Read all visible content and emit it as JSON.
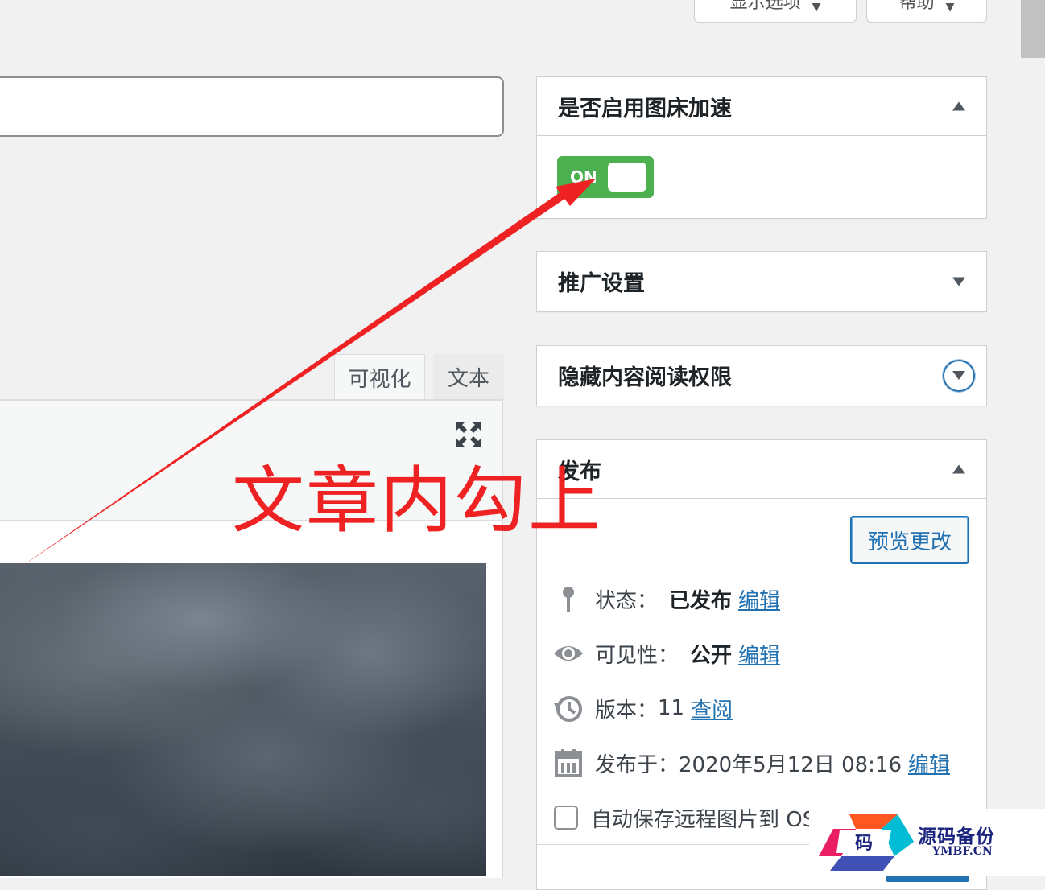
{
  "header": {
    "screen_options_label": "显示选项",
    "help_label": "帮助"
  },
  "editor": {
    "tab_visual": "可视化",
    "tab_text": "文本"
  },
  "boxes": {
    "image_accel": {
      "title": "是否启用图床加速",
      "switch_label": "ON",
      "enabled": true
    },
    "promo": {
      "title": "推广设置"
    },
    "hidden_content": {
      "title": "隐藏内容阅读权限"
    },
    "publish": {
      "title": "发布",
      "preview_button": "预览更改",
      "status_label": "状态：",
      "status_value": "已发布",
      "status_edit": "编辑",
      "visibility_label": "可见性：",
      "visibility_value": "公开",
      "visibility_edit": "编辑",
      "revisions_label": "版本：",
      "revisions_value": "11",
      "revisions_link": "查阅",
      "published_label": "发布于：",
      "published_value": "2020年5月12日 08:16",
      "published_edit": "编辑",
      "autosave_label": "自动保存远程图片到 OSS"
    }
  },
  "annotation": {
    "text": "文章内勾上",
    "color": "#ee2222"
  },
  "watermark": {
    "logo_char": "码",
    "name": "源码备份",
    "domain": "YMBF.CN"
  },
  "colors": {
    "accent": "#2271b1",
    "switch_on": "#4caf50"
  }
}
